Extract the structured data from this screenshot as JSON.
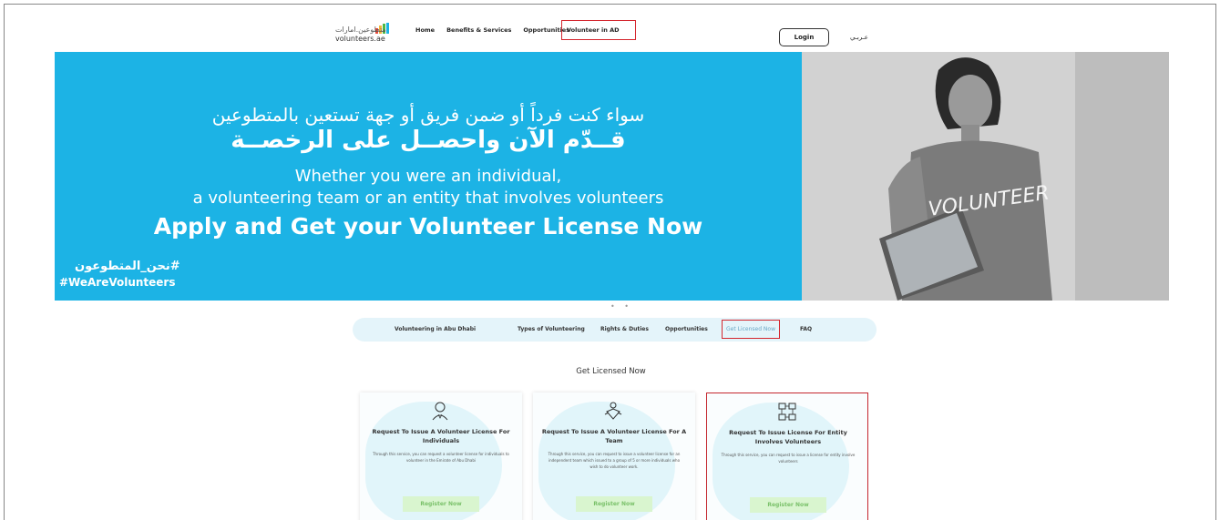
{
  "header": {
    "logo_ar": "متطوعين.امارات",
    "logo_en": "volunteers.ae",
    "nav": [
      "Home",
      "Benefits & Services",
      "Opportunities",
      "Volunteer in AD"
    ],
    "login_label": "Login",
    "lang_label": "عـربـي"
  },
  "hero": {
    "ar_line1": "سواء كنت فرداً أو ضمن فريق أو جهة تستعين بالمتطوعين",
    "ar_line2": "قــدّم الآن واحصــل على الرخصــة",
    "en_line1": "Whether you were an individual,",
    "en_line2": "a volunteering team or an entity that involves volunteers",
    "en_line3": "Apply and Get your Volunteer License Now",
    "hashtag_ar": "#نحن_المتطوعون",
    "hashtag_en": "#WeAreVolunteers",
    "photo_shirt_text": "VOLUNTEER"
  },
  "subnav": [
    "Volunteering in Abu Dhabi",
    "Types of Volunteering",
    "Rights & Duties",
    "Opportunities",
    "Get Licensed Now",
    "FAQ"
  ],
  "section_title": "Get Licensed Now",
  "cards": [
    {
      "icon": "person-icon",
      "title": "Request To Issue A Volunteer License For Individuals",
      "desc": "Through this service, you can request a volunteer license for individuals to volunteer in the Emirate of Abu Dhabi",
      "button": "Register Now"
    },
    {
      "icon": "team-hands-icon",
      "title": "Request To Issue A Volunteer License For A Team",
      "desc": "Through this service, you can request to issue a volunteer license for an independent team which issued to a group of 5 or more individuals who wish to do volunteer work.",
      "button": "Register Now"
    },
    {
      "icon": "entity-network-icon",
      "title": "Request To Issue License For Entity Involves Volunteers",
      "desc": "Through this service, you can request to issue a license for entity involve volunteers",
      "button": "Register Now"
    }
  ],
  "colors": {
    "hero_blue": "#1cb3e5",
    "highlight_red": "#d4262e",
    "button_green_bg": "#d9f5cf",
    "button_green_text": "#7ac16a"
  }
}
